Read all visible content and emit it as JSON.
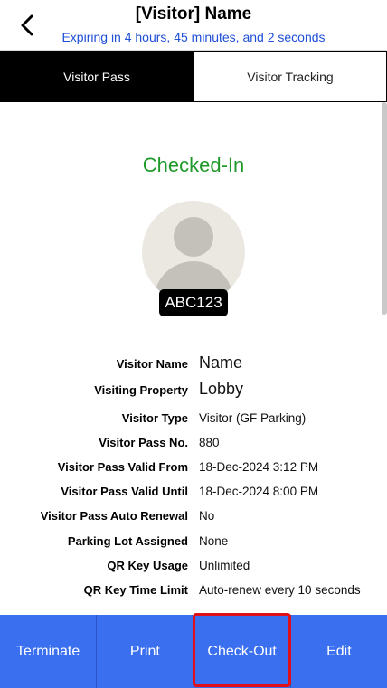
{
  "header": {
    "title": "[Visitor] Name",
    "subtitle": "Expiring in 4 hours, 45 minutes, and 2 seconds",
    "back_icon": "chevron-left-icon"
  },
  "tabs": [
    {
      "label": "Visitor Pass",
      "active": true
    },
    {
      "label": "Visitor Tracking",
      "active": false
    }
  ],
  "status": {
    "text": "Checked-In",
    "color": "#1f9a2a"
  },
  "plate": "ABC123",
  "details": [
    {
      "label": "Visitor Name",
      "value": "Name"
    },
    {
      "label": "Visiting Property",
      "value": "Lobby"
    },
    {
      "label": "Visitor Type",
      "value": "Visitor (GF Parking)"
    },
    {
      "label": "Visitor Pass No.",
      "value": "880"
    },
    {
      "label": "Visitor Pass Valid From",
      "value": "18-Dec-2024 3:12 PM"
    },
    {
      "label": "Visitor Pass Valid Until",
      "value": "18-Dec-2024 8:00 PM"
    },
    {
      "label": "Visitor Pass Auto Renewal",
      "value": "No"
    },
    {
      "label": "Parking Lot Assigned",
      "value": "None"
    },
    {
      "label": "QR Key Usage",
      "value": "Unlimited"
    },
    {
      "label": "QR Key Time Limit",
      "value": "Auto-renew every 10 seconds"
    }
  ],
  "footer": {
    "terminate": "Terminate",
    "print": "Print",
    "checkout": "Check-Out",
    "edit": "Edit"
  },
  "colors": {
    "accent": "#3a6ff0",
    "active_tab": "#000000",
    "highlight": "#e0101a"
  }
}
